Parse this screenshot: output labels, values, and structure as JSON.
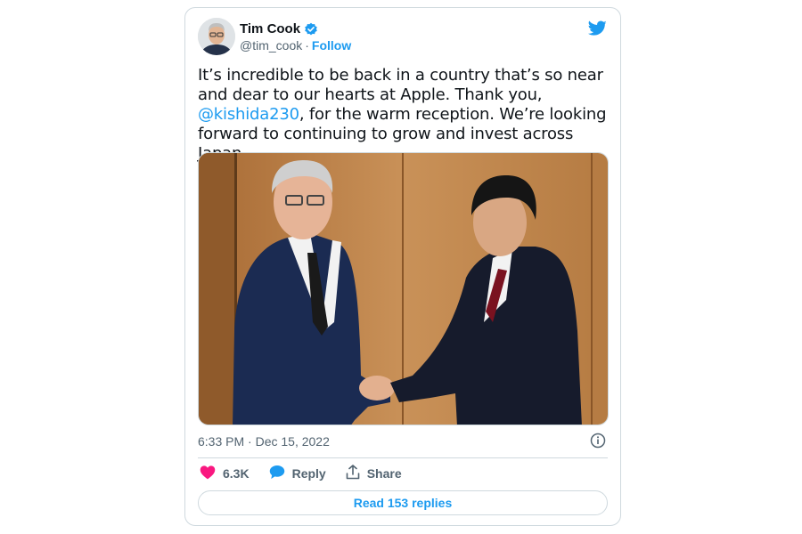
{
  "author": {
    "display_name": "Tim Cook",
    "handle": "@tim_cook",
    "separator": "·",
    "follow_label": "Follow",
    "verified_icon": "verified-badge-icon"
  },
  "brand_icon": "twitter-bird-icon",
  "tweet": {
    "text_before": "It’s incredible to be back in a country that’s so near and dear to our hearts at Apple. Thank you, ",
    "mention": "@kishida230",
    "text_after": ", for the warm reception. We’re looking forward to continuing to grow and invest across Japan."
  },
  "media": {
    "kind": "photo"
  },
  "timestamp": "6:33 PM · Dec 15, 2022",
  "actions": {
    "like_count": "6.3K",
    "reply_label": "Reply",
    "share_label": "Share"
  },
  "read_replies_label": "Read 153 replies",
  "colors": {
    "accent": "#1d9bf0",
    "like": "#f91880",
    "text": "#0f1419",
    "muted": "#536471",
    "border": "#cfd9de"
  }
}
